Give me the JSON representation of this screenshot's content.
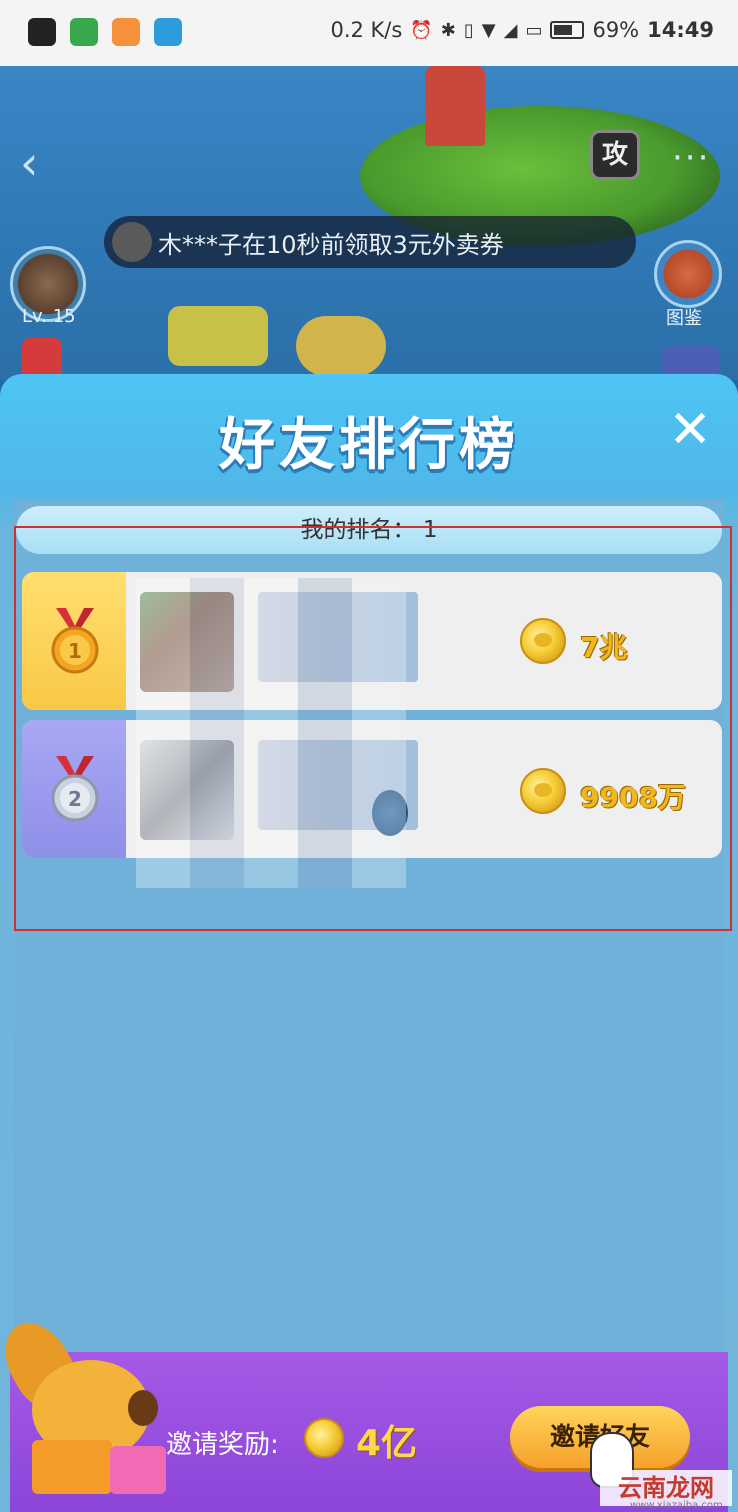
{
  "status_bar": {
    "network_speed": "0.2 K/s",
    "battery_percent": "69%",
    "time": "14:49",
    "apps": [
      "qq-icon",
      "qutoutiao-icon",
      "health-icon",
      "send-icon"
    ]
  },
  "game": {
    "attack_label": "攻",
    "more_label": "···",
    "ticker_text": "木***子在10秒前领取3元外卖券",
    "level_label": "Lv. 15",
    "album_label": "图鉴"
  },
  "leaderboard": {
    "title": "好友排行榜",
    "my_rank_label": "我的排名：",
    "my_rank_value": "1",
    "entries": [
      {
        "rank": 1,
        "medal": "gold-medal-icon",
        "coins": "7兆"
      },
      {
        "rank": 2,
        "medal": "silver-medal-icon",
        "coins": "9908万"
      }
    ]
  },
  "invite": {
    "label": "邀请奖励:",
    "amount": "4亿",
    "button_label": "邀请好友"
  },
  "watermark": {
    "text": "云南龙网",
    "url": "www.xiazaiba.com"
  },
  "colors": {
    "panel_blue": "#4ec5f4",
    "gold_side": "#f9c845",
    "silver_side": "#8e8fe8",
    "coin_text": "#f0b81e",
    "invite_purple": "#9a4fe0",
    "invite_button": "#f6a12a"
  }
}
